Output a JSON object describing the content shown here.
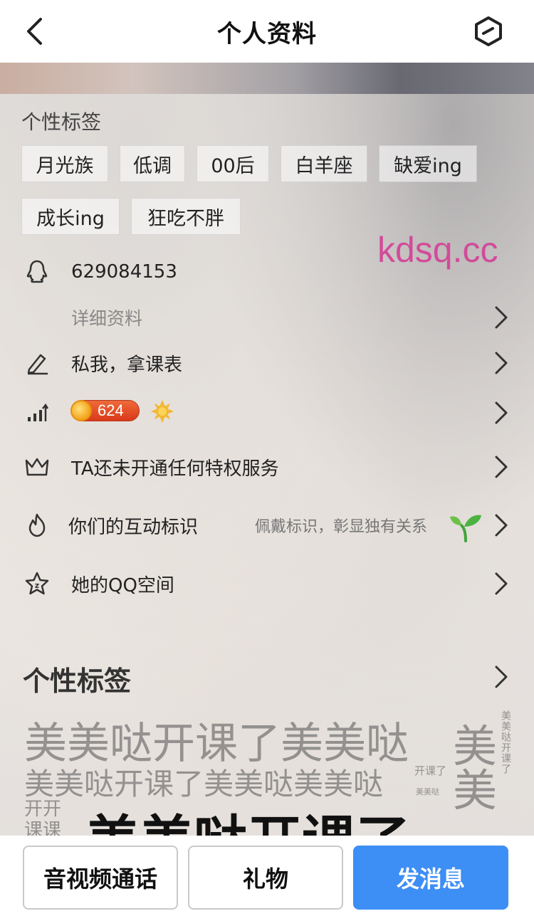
{
  "header": {
    "title": "个人资料"
  },
  "watermark": "kdsq.cc",
  "tags_section": {
    "title": "个性标签",
    "tags": [
      "月光族",
      "低调",
      "00后",
      "白羊座",
      "缺爱ing",
      "成长ing",
      "狂吃不胖"
    ]
  },
  "info": {
    "qq_number": "629084153",
    "detail_link": "详细资料",
    "signature": "私我，拿课表",
    "level": "624",
    "privilege": "TA还未开通任何特权服务",
    "interaction": {
      "label": "你们的互动标识",
      "hint": "佩戴标识，彰显独有关系"
    },
    "qzone": "她的QQ空间"
  },
  "tag_wall": {
    "title": "个性标签",
    "words": [
      "美美哒开课了美美哒",
      "美",
      "美",
      "美美哒开课了美美哒美美哒",
      "开课了",
      "美美哒",
      "开开",
      "课课",
      "美美哒开课了",
      "美美哒开课了"
    ]
  },
  "footer": {
    "call_button": "音视频通话",
    "gift_button": "礼物",
    "message_button": "发消息"
  },
  "colors": {
    "primary": "#3d8ef5",
    "watermark": "#d24b9a"
  }
}
